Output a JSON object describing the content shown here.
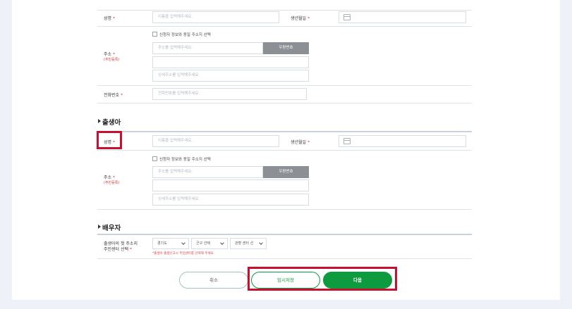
{
  "applicant": {
    "name_label": "성명",
    "name_placeholder": "이름을 입력해주세요.",
    "birth_label": "생년월일",
    "same_address_label": "신청자 정보와 동일 주소지 선택",
    "address_label": "주소",
    "address_sub": "(주민등록)",
    "address_placeholder": "주소를 입력해주세요.",
    "zip_button": "우편번호",
    "detail_address_placeholder": "상세주소를 입력해주세요.",
    "phone_label": "전화번호",
    "phone_placeholder": "전화번호를 입력해주세요."
  },
  "newborn": {
    "section_title": "출생아",
    "name_label": "성명",
    "name_placeholder": "이름을 입력해주세요.",
    "birth_label": "생년월일",
    "same_address_label": "신청자 정보와 동일 주소지 선택",
    "address_label": "주소",
    "address_sub": "(주민등록)",
    "address_placeholder": "주소를 입력해주세요.",
    "zip_button": "우편번호",
    "detail_address_placeholder": "상세주소를 입력해주세요."
  },
  "spouse": {
    "section_title": "배우자",
    "center_label_line1": "출생아의 첫 주소지",
    "center_label_line2": "주민센터 선택",
    "select_province": "경기도",
    "select_district": "군구 선택",
    "select_center": "관할 센터 선",
    "note": "*출생아 출생신고시 주민센터를 선택해 주세요."
  },
  "required_mark": "*",
  "buttons": {
    "cancel": "취소",
    "temp_save": "임시저장",
    "next": "다음"
  },
  "colors": {
    "primary_green": "#0e9a3e",
    "required_red": "#e03b3b",
    "highlight_red": "#c8102e"
  }
}
